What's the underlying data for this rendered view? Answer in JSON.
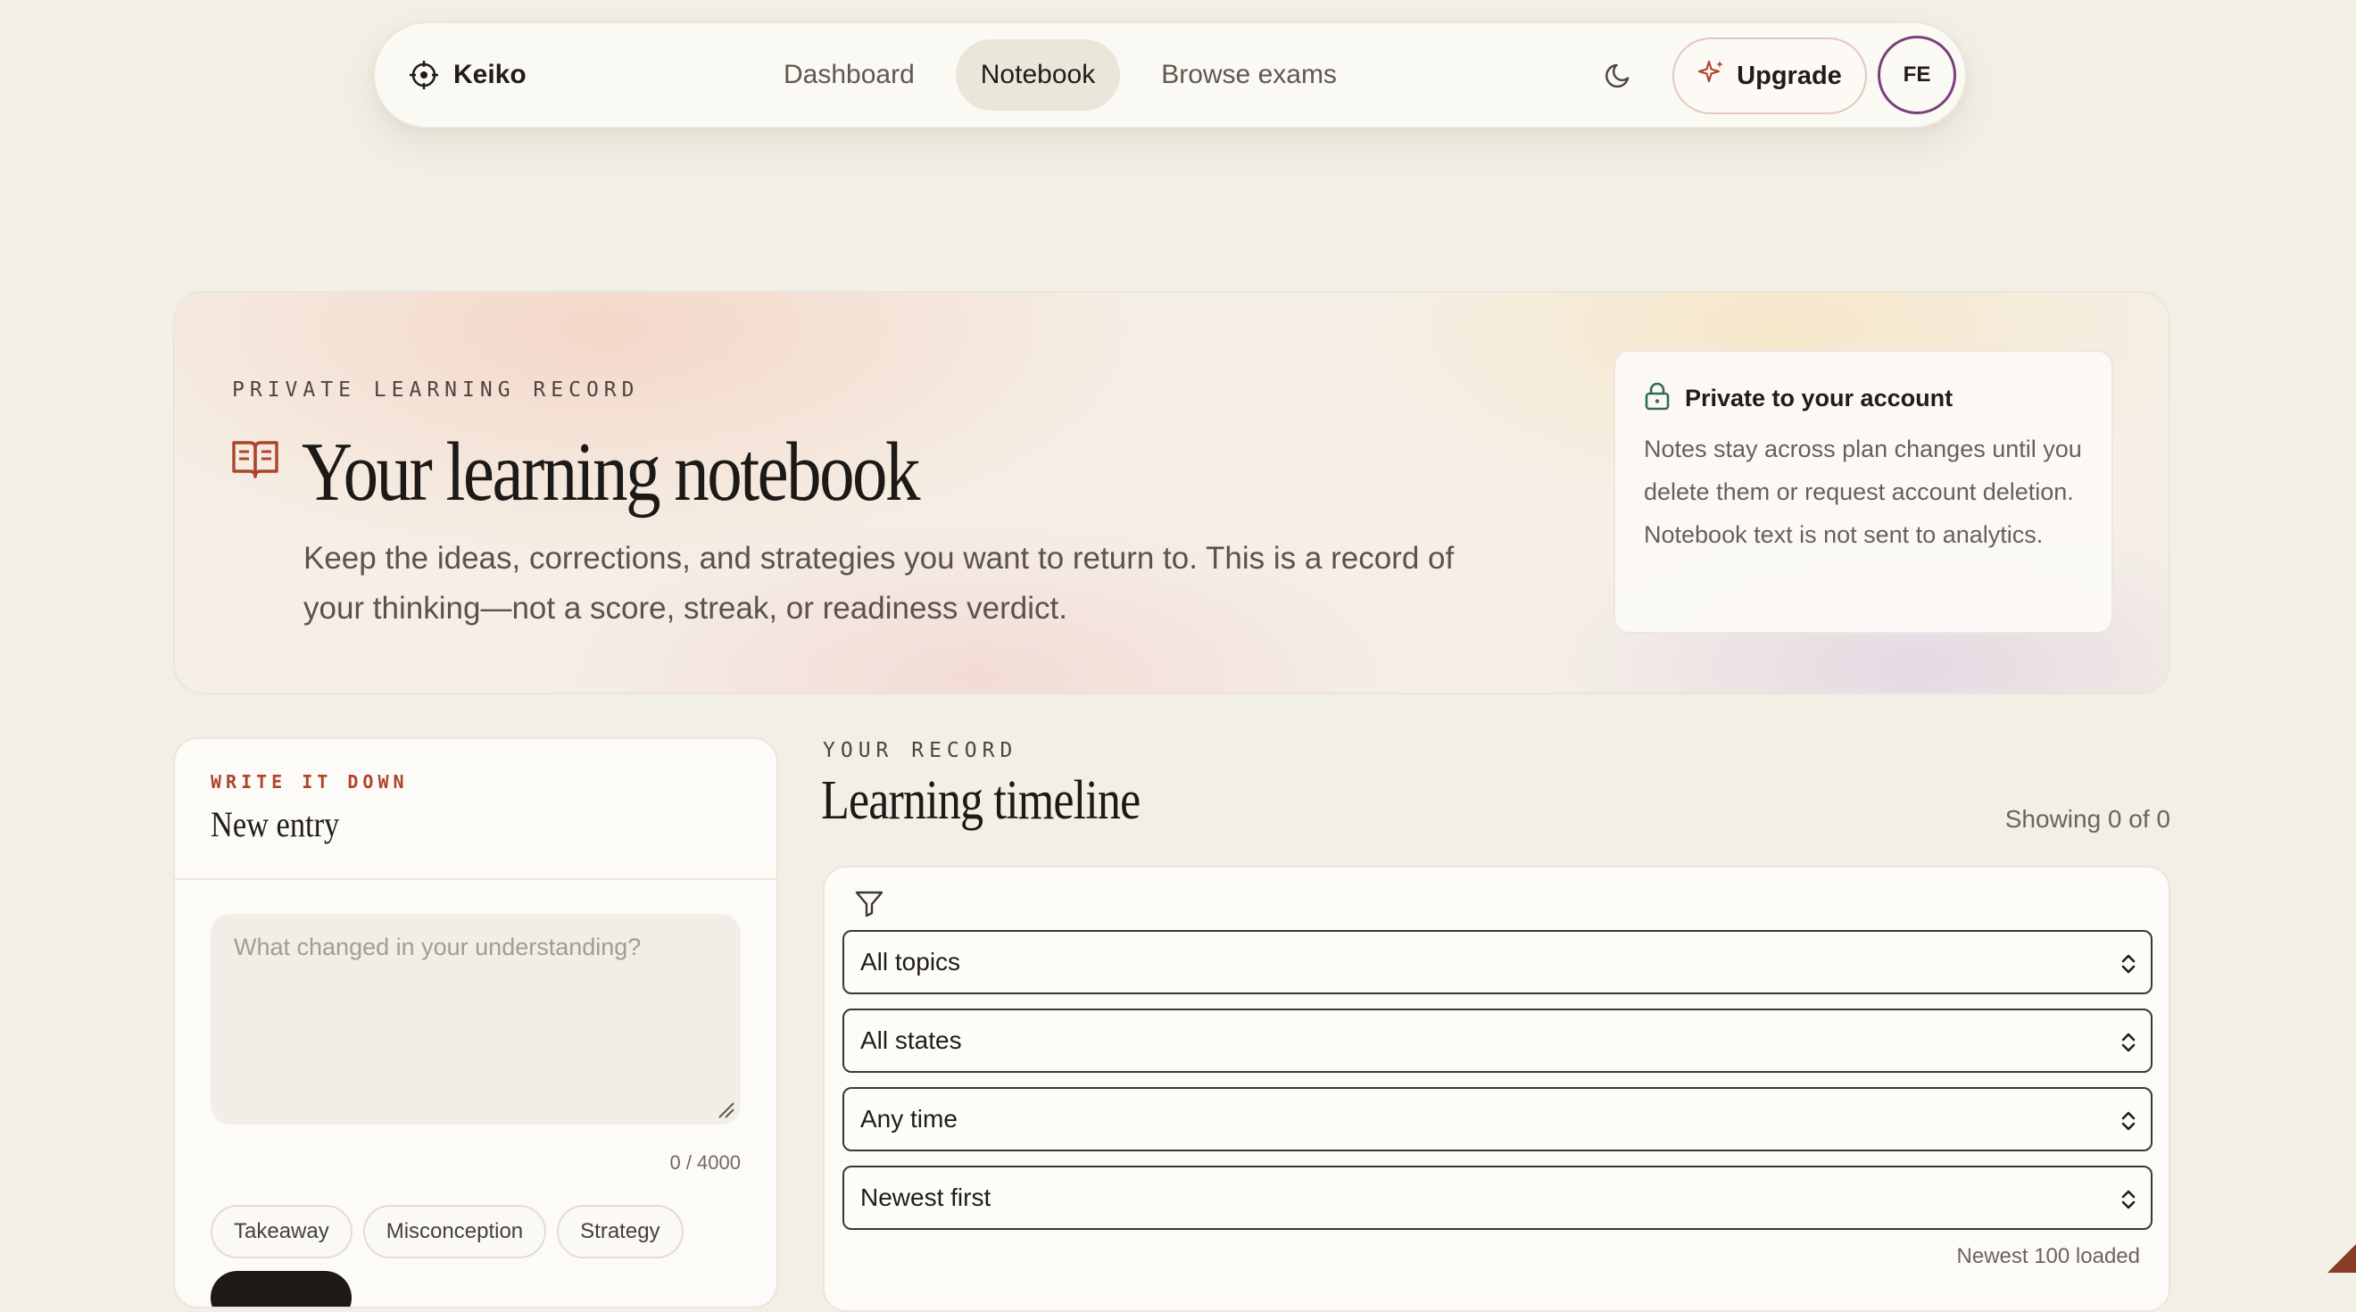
{
  "nav": {
    "brand": "Keiko",
    "links": [
      "Dashboard",
      "Notebook",
      "Browse exams"
    ],
    "active_link": "Notebook",
    "upgrade_label": "Upgrade",
    "avatar_initials": "FE",
    "avatar_ring_color": "#7a3f7d"
  },
  "hero": {
    "eyebrow": "PRIVATE LEARNING RECORD",
    "title": "Your learning notebook",
    "description": "Keep the ideas, corrections, and strategies you want to return to. This is a record of your thinking—not a score, streak, or readiness verdict.",
    "privacy": {
      "title": "Private to your account",
      "text": "Notes stay across plan changes until you delete them or request account deletion. Notebook text is not sent to analytics."
    }
  },
  "entry": {
    "eyebrow": "WRITE IT DOWN",
    "title": "New entry",
    "placeholder": "What changed in your understanding?",
    "char_count": "0 / 4000",
    "chips": [
      "Takeaway",
      "Misconception",
      "Strategy"
    ]
  },
  "timeline": {
    "eyebrow": "YOUR RECORD",
    "title": "Learning timeline",
    "showing": "Showing 0 of 0",
    "filters": {
      "topic": "All topics",
      "state": "All states",
      "time": "Any time",
      "sort": "Newest first"
    },
    "loaded_note": "Newest 100 loaded"
  },
  "colors": {
    "accent": "#b0432c",
    "background": "#f2efe6",
    "lock_icon": "#2f6b5a"
  },
  "icons": {
    "brand": "crosshair-icon",
    "theme": "moon-icon",
    "upgrade": "sparkle-icon",
    "hero": "open-book-icon",
    "privacy": "lock-icon",
    "filter": "filter-icon",
    "select": "chevron-up-down-icon"
  }
}
